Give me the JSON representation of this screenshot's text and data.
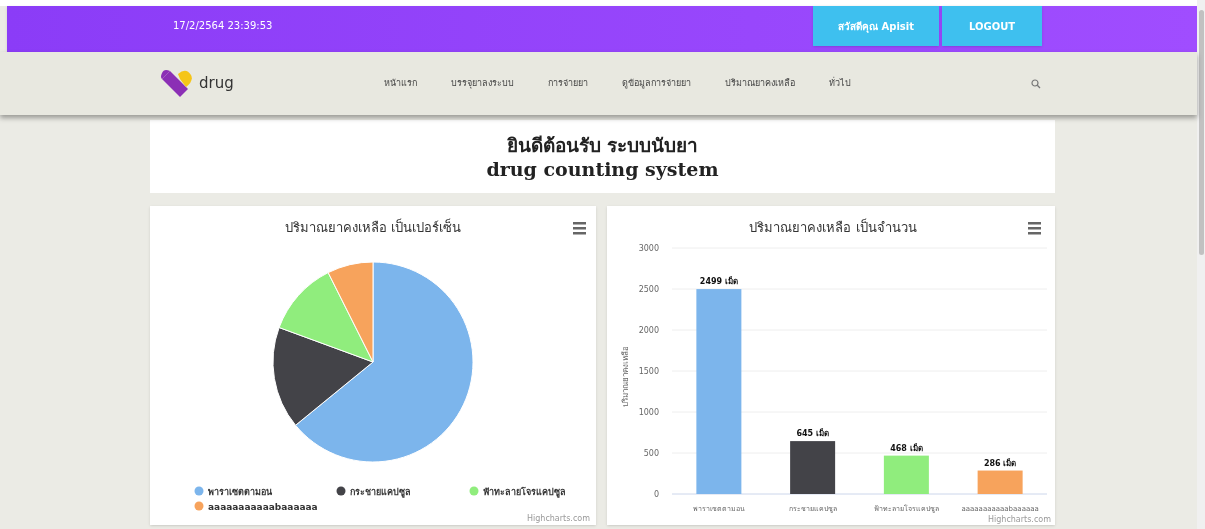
{
  "top_bar": {
    "datetime": "17/2/2564 23:39:53",
    "greeting_button": "สวัสดีคุณ Apisit",
    "logout_button": "LOGOUT"
  },
  "navbar": {
    "logo_text": "drug",
    "items": [
      {
        "label": "หน้าแรก"
      },
      {
        "label": "บรรจุยาลงระบบ"
      },
      {
        "label": "การจ่ายยา"
      },
      {
        "label": "ดูข้อมูลการจ่ายยา"
      },
      {
        "label": "ปริมาณยาคงเหลือ"
      },
      {
        "label": "ทั่วไป"
      }
    ]
  },
  "welcome": {
    "title": "ยินดีต้อนรับ ระบบนับยา",
    "subtitle": "drug counting system"
  },
  "pie_card": {
    "credit": "Highcharts.com",
    "chart_data": {
      "type": "pie",
      "title": "ปริมาณยาคงเหลือ เป็นเปอร์เซ็น",
      "categories": [
        "พาราเซตตามอน",
        "กระชายแคปซูล",
        "ฟ้าทะลายโจรแคปซูล",
        "aaaaaaaaaaabaaaaaa"
      ],
      "values": [
        64.1,
        16.5,
        12.0,
        7.4
      ],
      "colors": [
        "#7cb5ec",
        "#434348",
        "#90ed7d",
        "#f7a35c"
      ],
      "legend": true
    }
  },
  "bar_card": {
    "credit": "Highcharts.com",
    "chart_data": {
      "type": "bar",
      "title": "ปริมาณยาคงเหลือ เป็นจำนวน",
      "ylabel": "ปริมาณยาคงเหลือ",
      "categories": [
        "พาราเซตตามอน",
        "กระชายแคปซูล",
        "ฟ้าทะลายโจรแคปซูล",
        "aaaaaaaaaaabaaaaaa"
      ],
      "values": [
        2499,
        645,
        468,
        286
      ],
      "colors": [
        "#7cb5ec",
        "#434348",
        "#90ed7d",
        "#f7a35c"
      ],
      "grid": true,
      "ylim": [
        0,
        3000
      ],
      "yticks": [
        0,
        500,
        1000,
        1500,
        2000,
        2500,
        3000
      ],
      "value_labels": [
        "2499 เม็ด",
        "645 เม็ด",
        "468 เม็ด",
        "286 เม็ด"
      ]
    }
  }
}
